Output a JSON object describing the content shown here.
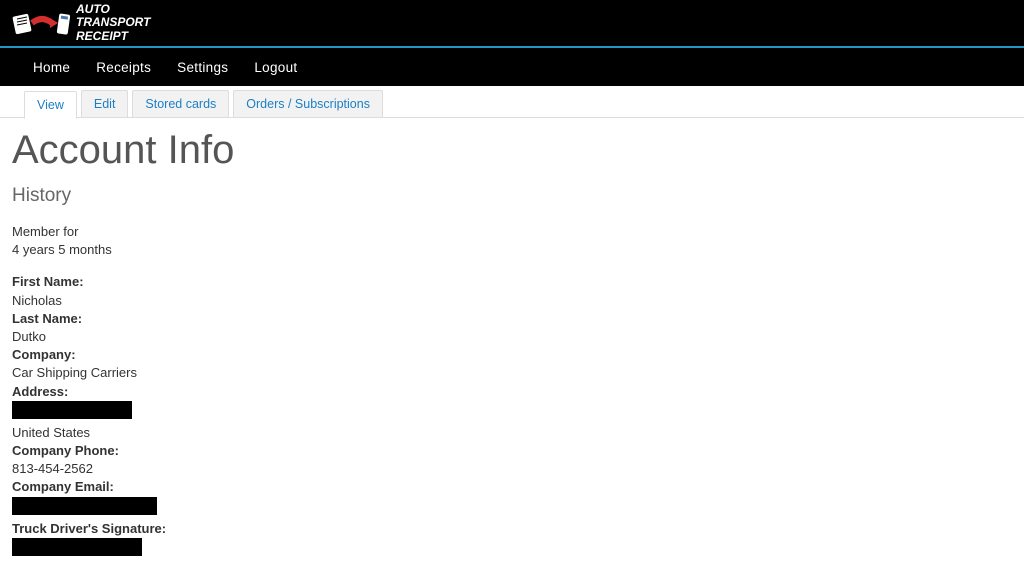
{
  "logo": {
    "line1": "AUTO",
    "line2": "TRANSPORT",
    "line3": "RECEIPT"
  },
  "nav": {
    "home": "Home",
    "receipts": "Receipts",
    "settings": "Settings",
    "logout": "Logout"
  },
  "tabs": {
    "view": "View",
    "edit": "Edit",
    "stored_cards": "Stored cards",
    "orders": "Orders / Subscriptions"
  },
  "page": {
    "title": "Account Info",
    "section_title": "History"
  },
  "fields": {
    "member_for_label": "Member for",
    "member_for_value": "4 years 5 months",
    "first_name_label": "First Name:",
    "first_name_value": "Nicholas",
    "last_name_label": "Last Name:",
    "last_name_value": "Dutko",
    "company_label": "Company:",
    "company_value": "Car Shipping Carriers",
    "address_label": "Address:",
    "country_value": "United States",
    "company_phone_label": "Company Phone:",
    "company_phone_value": "813-454-2562",
    "company_email_label": "Company Email:",
    "signature_label": "Truck Driver's Signature:"
  }
}
